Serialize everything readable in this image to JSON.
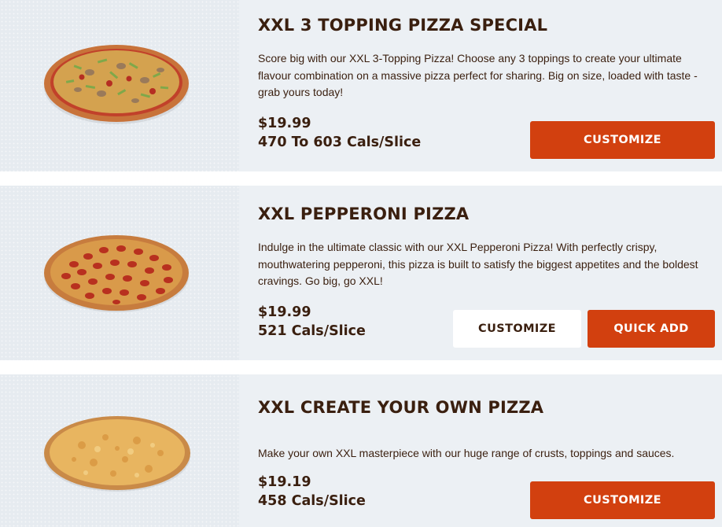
{
  "items": [
    {
      "title": "XXL 3 TOPPING PIZZA SPECIAL",
      "description": "Score big with our XXL 3-Topping Pizza! Choose any 3 toppings to create your ultimate flavour combination on a massive pizza perfect for sharing. Big on size, loaded with taste - grab yours today!",
      "price": "$19.99",
      "calories": "470 To 603 Cals/Slice",
      "customize_label": "CUSTOMIZE",
      "image_icon": "pizza-supreme-icon"
    },
    {
      "title": "XXL PEPPERONI PIZZA",
      "description": "Indulge in the ultimate classic with our XXL Pepperoni Pizza! With perfectly crispy, mouthwatering pepperoni, this pizza is built to satisfy the biggest appetites and the boldest cravings. Go big, go XXL!",
      "price": "$19.99",
      "calories": "521 Cals/Slice",
      "customize_label": "CUSTOMIZE",
      "quick_add_label": "QUICK ADD",
      "image_icon": "pizza-pepperoni-icon"
    },
    {
      "title": "XXL CREATE YOUR OWN PIZZA",
      "description": "Make your own XXL masterpiece with our huge range of crusts, toppings and sauces.",
      "price": "$19.19",
      "calories": "458 Cals/Slice",
      "customize_label": "CUSTOMIZE",
      "image_icon": "pizza-cheese-icon"
    }
  ],
  "colors": {
    "accent": "#d2400f",
    "text": "#3a1f0f",
    "card_bg": "#ecf0f4"
  }
}
